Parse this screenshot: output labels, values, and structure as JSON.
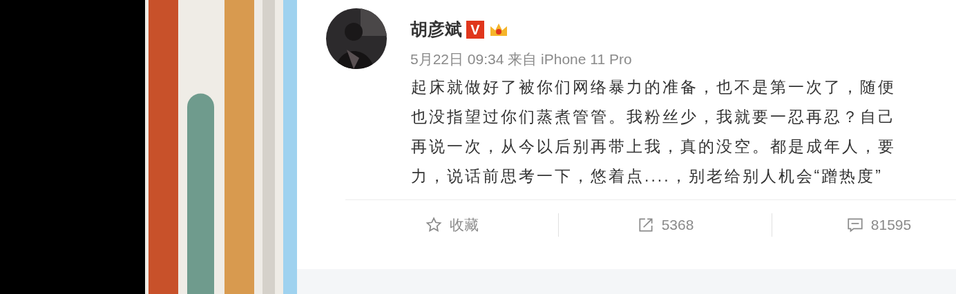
{
  "post": {
    "author": "胡彦斌",
    "verified_badge": "V",
    "meta": "5月22日 09:34 来自 iPhone 11 Pro",
    "lines": [
      "起床就做好了被你们网络暴力的准备，也不是第一次了，随便",
      "也没指望过你们蒸煮管管。我粉丝少，我就要一忍再忍？自己",
      "再说一次，从今以后别再带上我，真的没空。都是成年人，要",
      "力，说话前思考一下，悠着点....，别老给别人机会“蹭热度”"
    ]
  },
  "actions": [
    {
      "kind": "favorite",
      "label": "收藏"
    },
    {
      "kind": "repost",
      "label": "5368"
    },
    {
      "kind": "comment",
      "label": "81595"
    }
  ]
}
